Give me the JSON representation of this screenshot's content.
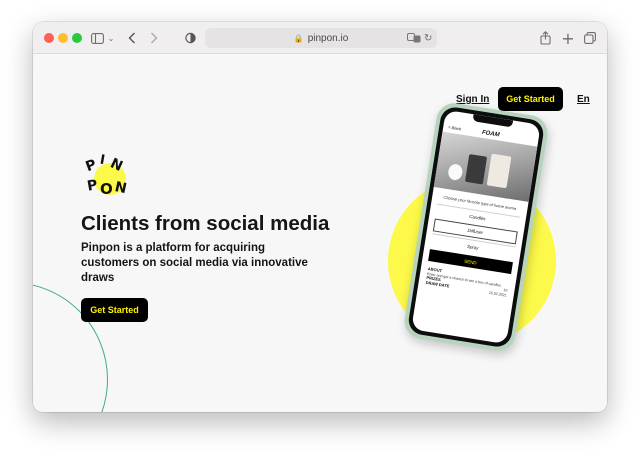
{
  "browser": {
    "url": "pinpon.io"
  },
  "nav": {
    "sign_in": "Sign In",
    "get_started": "Get Started",
    "language": "En"
  },
  "brand": {
    "logo_letters": [
      "P",
      "I",
      "N",
      "P",
      "O",
      "N"
    ],
    "accent_color": "#fff200",
    "circle_color": "#fcf94a"
  },
  "hero": {
    "title": "Clients from social media",
    "subtitle": "Pinpon is a platform for acquiring customers on social media via innovative draws",
    "cta": "Get Started"
  },
  "phone_screen": {
    "back": "< Back",
    "title": "FOAM",
    "prompt": "Choose your favorite type of home aroma",
    "options": [
      "Candles",
      "Diffuser",
      "Spray"
    ],
    "send": "SEND",
    "about_label": "ABOUT",
    "about_text": "Enter and get a chance to win a box of candles.",
    "prizes_label": "PRIZES",
    "prizes_value": "10",
    "draw_date_label": "DRAW DATE",
    "draw_date_value": "15.02.2021"
  }
}
